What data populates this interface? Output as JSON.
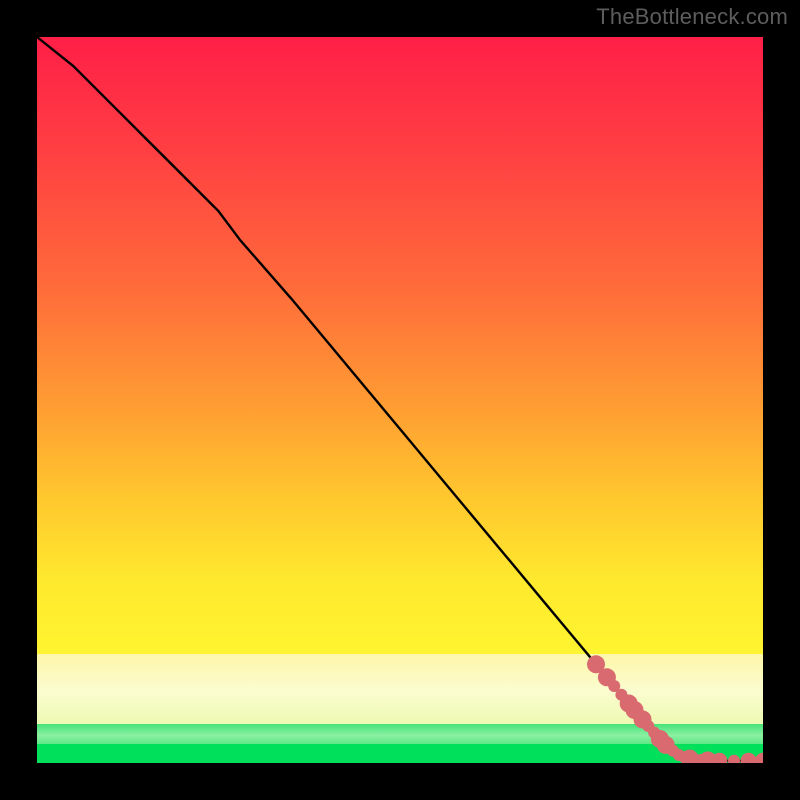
{
  "watermark": "TheBottleneck.com",
  "colors": {
    "line": "#000000",
    "point_fill": "#d96a6f",
    "point_stroke": "#b24e53",
    "frame_bg": "#000000"
  },
  "chart_data": {
    "type": "line",
    "title": "",
    "xlabel": "",
    "ylabel": "",
    "xlim": [
      0,
      100
    ],
    "ylim": [
      0,
      100
    ],
    "grid": false,
    "legend": false,
    "series": [
      {
        "name": "curve",
        "kind": "line",
        "x": [
          0,
          5,
          10,
          15,
          20,
          25,
          28,
          35,
          40,
          45,
          50,
          55,
          60,
          65,
          70,
          75,
          80,
          83,
          85,
          87,
          89,
          90,
          92,
          94,
          96,
          98,
          100
        ],
        "y": [
          100,
          96,
          91,
          86,
          81,
          76,
          72,
          64,
          58,
          52,
          46,
          40,
          34,
          28,
          22,
          16,
          10,
          6,
          4,
          2,
          1,
          0.6,
          0.4,
          0.3,
          0.3,
          0.3,
          0.3
        ]
      },
      {
        "name": "cluster",
        "kind": "scatter",
        "x": [
          77,
          78.5,
          79.5,
          80.5,
          81.5,
          82.3,
          83.4,
          84.2,
          85.0,
          85.8,
          86.6,
          87.6,
          88.4,
          89.2,
          89.9,
          90.6,
          91.4,
          92.4,
          94.0,
          96.0,
          98.0,
          100.0
        ],
        "y": [
          13.6,
          11.8,
          10.6,
          9.4,
          8.2,
          7.3,
          6.0,
          5.1,
          4.2,
          3.3,
          2.5,
          1.7,
          1.1,
          0.8,
          0.6,
          0.5,
          0.4,
          0.35,
          0.3,
          0.3,
          0.3,
          0.3
        ],
        "r": [
          9,
          9,
          6,
          6,
          9,
          9,
          9,
          6,
          6,
          9,
          9,
          6,
          6,
          6,
          9,
          6,
          6,
          9,
          8,
          6,
          8,
          8
        ]
      }
    ],
    "gradient_stops": [
      {
        "pos": 0.0,
        "color": "#ff1f47"
      },
      {
        "pos": 0.5,
        "color": "#ff9a33"
      },
      {
        "pos": 0.83,
        "color": "#fff22f"
      },
      {
        "pos": 0.9,
        "color": "#fbfccf"
      },
      {
        "pos": 0.95,
        "color": "#8af0a2"
      },
      {
        "pos": 1.0,
        "color": "#00e05a"
      }
    ]
  }
}
